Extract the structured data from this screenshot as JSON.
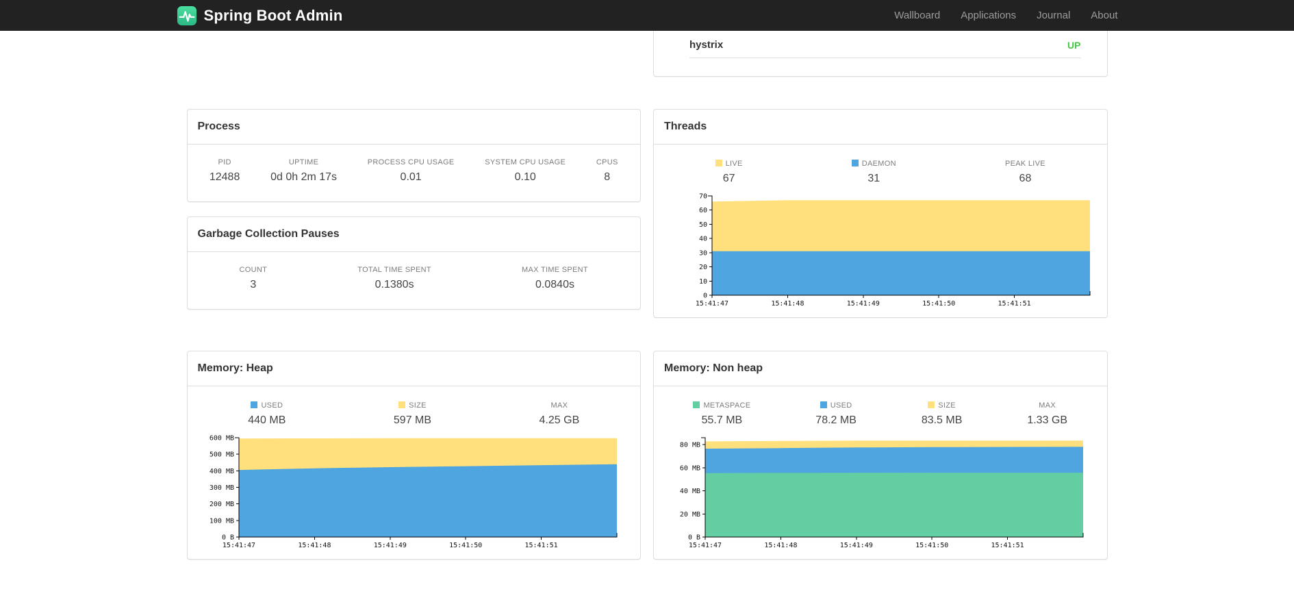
{
  "navbar": {
    "brand": "Spring Boot Admin",
    "items": [
      {
        "label": "Wallboard"
      },
      {
        "label": "Applications"
      },
      {
        "label": "Journal"
      },
      {
        "label": "About"
      }
    ]
  },
  "health": {
    "rows": [
      {
        "name": "hystrix",
        "status": "UP",
        "status_color": "#46c746"
      }
    ]
  },
  "process": {
    "title": "Process",
    "metrics": [
      {
        "label": "PID",
        "value": "12488"
      },
      {
        "label": "UPTIME",
        "value": "0d 0h 2m 17s"
      },
      {
        "label": "PROCESS CPU USAGE",
        "value": "0.01"
      },
      {
        "label": "SYSTEM CPU USAGE",
        "value": "0.10"
      },
      {
        "label": "CPUS",
        "value": "8"
      }
    ]
  },
  "gc": {
    "title": "Garbage Collection Pauses",
    "metrics": [
      {
        "label": "COUNT",
        "value": "3"
      },
      {
        "label": "TOTAL TIME SPENT",
        "value": "0.1380s"
      },
      {
        "label": "MAX TIME SPENT",
        "value": "0.0840s"
      }
    ]
  },
  "threads": {
    "title": "Threads",
    "legend": [
      {
        "label": "LIVE",
        "value": "67",
        "color": "#FFE07D"
      },
      {
        "label": "DAEMON",
        "value": "31",
        "color": "#4FA5DF"
      },
      {
        "label": "PEAK LIVE",
        "value": "68",
        "color": null
      }
    ]
  },
  "heap": {
    "title": "Memory: Heap",
    "legend": [
      {
        "label": "USED",
        "value": "440 MB",
        "color": "#4FA5DF"
      },
      {
        "label": "SIZE",
        "value": "597 MB",
        "color": "#FFE07D"
      },
      {
        "label": "MAX",
        "value": "4.25 GB",
        "color": null
      }
    ]
  },
  "nonheap": {
    "title": "Memory: Non heap",
    "legend": [
      {
        "label": "METASPACE",
        "value": "55.7 MB",
        "color": "#63CEA2"
      },
      {
        "label": "USED",
        "value": "78.2 MB",
        "color": "#4FA5DF"
      },
      {
        "label": "SIZE",
        "value": "83.5 MB",
        "color": "#FFE07D"
      },
      {
        "label": "MAX",
        "value": "1.33 GB",
        "color": null
      }
    ]
  },
  "chart_data": [
    {
      "id": "threads-chart",
      "type": "area",
      "title": "Threads",
      "ymax": 70,
      "x_intervals": 5,
      "x_ticks": [
        "15:41:47",
        "15:41:48",
        "15:41:49",
        "15:41:50",
        "15:41:51"
      ],
      "y_ticks": [
        {
          "v": 0,
          "label": "0"
        },
        {
          "v": 10,
          "label": "10"
        },
        {
          "v": 20,
          "label": "20"
        },
        {
          "v": 30,
          "label": "30"
        },
        {
          "v": 40,
          "label": "40"
        },
        {
          "v": 50,
          "label": "50"
        },
        {
          "v": 60,
          "label": "60"
        },
        {
          "v": 70,
          "label": "70"
        }
      ],
      "series": [
        {
          "name": "LIVE",
          "color": "#FFE07D",
          "values": [
            66,
            67,
            67,
            67,
            67,
            67
          ]
        },
        {
          "name": "DAEMON",
          "color": "#4FA5DF",
          "values": [
            31,
            31,
            31,
            31,
            31,
            31
          ]
        }
      ]
    },
    {
      "id": "heap-chart",
      "type": "area",
      "title": "Memory: Heap",
      "ymax": 600,
      "x_intervals": 5,
      "x_ticks": [
        "15:41:47",
        "15:41:48",
        "15:41:49",
        "15:41:50",
        "15:41:51"
      ],
      "y_ticks": [
        {
          "v": 0,
          "label": "0 B"
        },
        {
          "v": 100,
          "label": "100 MB"
        },
        {
          "v": 200,
          "label": "200 MB"
        },
        {
          "v": 300,
          "label": "300 MB"
        },
        {
          "v": 400,
          "label": "400 MB"
        },
        {
          "v": 500,
          "label": "500 MB"
        },
        {
          "v": 600,
          "label": "600 MB"
        }
      ],
      "series": [
        {
          "name": "SIZE",
          "color": "#FFE07D",
          "values": [
            595,
            596,
            597,
            597,
            597,
            597
          ]
        },
        {
          "name": "USED",
          "color": "#4FA5DF",
          "values": [
            405,
            415,
            422,
            428,
            434,
            440
          ]
        }
      ]
    },
    {
      "id": "nonheap-chart",
      "type": "area",
      "title": "Memory: Non heap",
      "ymax": 86,
      "x_intervals": 5,
      "x_ticks": [
        "15:41:47",
        "15:41:48",
        "15:41:49",
        "15:41:50",
        "15:41:51"
      ],
      "y_ticks": [
        {
          "v": 0,
          "label": "0 B"
        },
        {
          "v": 20,
          "label": "20 MB"
        },
        {
          "v": 40,
          "label": "40 MB"
        },
        {
          "v": 60,
          "label": "60 MB"
        },
        {
          "v": 80,
          "label": "80 MB"
        }
      ],
      "series": [
        {
          "name": "SIZE",
          "color": "#FFE07D",
          "values": [
            82.8,
            83.2,
            83.5,
            83.5,
            83.5,
            83.5
          ]
        },
        {
          "name": "USED",
          "color": "#4FA5DF",
          "values": [
            76.5,
            77,
            77.5,
            77.8,
            78,
            78.2
          ]
        },
        {
          "name": "METASPACE",
          "color": "#63CEA2",
          "values": [
            55.4,
            55.5,
            55.6,
            55.7,
            55.7,
            55.7
          ]
        }
      ]
    }
  ]
}
